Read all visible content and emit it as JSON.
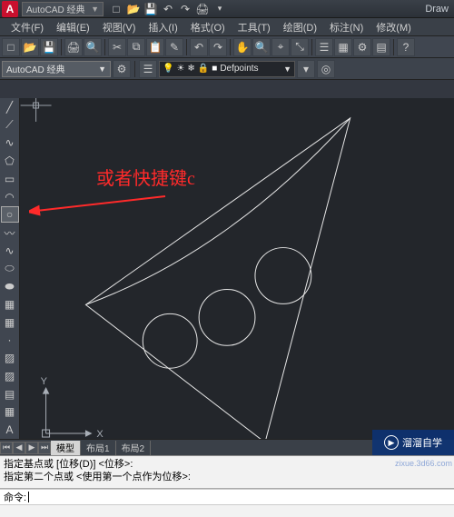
{
  "title_app": "Draw",
  "workspace_title": "AutoCAD 经典",
  "menu": [
    "文件(F)",
    "编辑(E)",
    "视图(V)",
    "插入(I)",
    "格式(O)",
    "工具(T)",
    "绘图(D)",
    "标注(N)",
    "修改(M)"
  ],
  "workspace_combo": "AutoCAD 经典",
  "layer_combo": "Defpoints",
  "tabs": {
    "model": "模型",
    "layout1": "布局1",
    "layout2": "布局2"
  },
  "annotation_text": "或者快捷键c",
  "axes": {
    "x": "X",
    "y": "Y"
  },
  "cmd_lines": [
    "指定基点或 [位移(D)] <位移>:",
    "指定第二个点或 <使用第一个点作为位移>:"
  ],
  "cmd_prompt": "命令:",
  "watermark": {
    "brand": "溜溜自学",
    "url": "zixue.3d66.com"
  },
  "icons": {
    "new": "□",
    "open": "📂",
    "save": "💾",
    "undo": "↶",
    "redo": "↷",
    "plot": "🖨",
    "down": "▾",
    "search": "◎",
    "dash": "—",
    "bulb": "💡",
    "sun": "☀",
    "freeze": "❄",
    "lock": "🔒",
    "color": "■",
    "line": "╱",
    "pline": "⟋",
    "poly": "⬠",
    "rect": "▭",
    "arc": "◠",
    "circle": "○",
    "rev": "〰",
    "spline": "∿",
    "ellipse": "⬭",
    "ea": "⬬",
    "block": "▦",
    "point": "·",
    "hatch": "▨",
    "region": "▤",
    "table": "▦",
    "text": "A"
  }
}
